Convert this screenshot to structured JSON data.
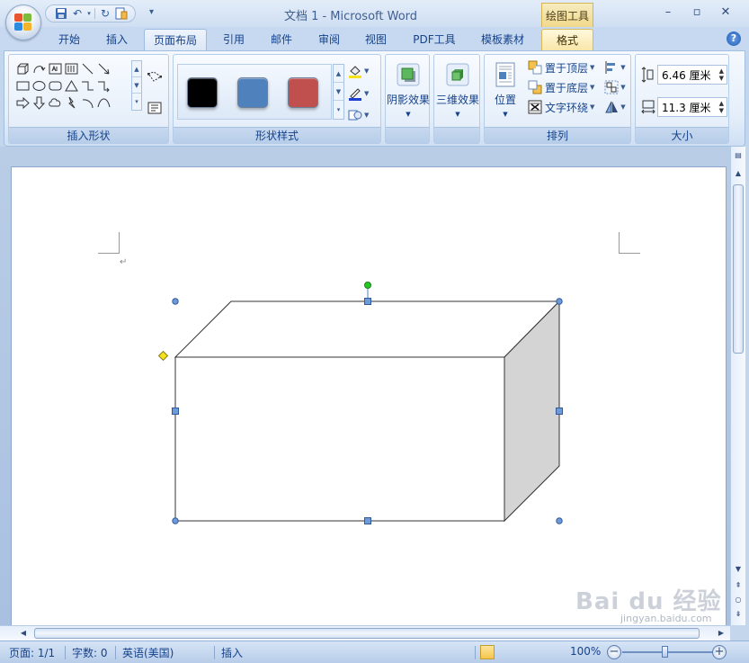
{
  "window": {
    "title": "文档 1 - Microsoft Word",
    "context_tab_group": "绘图工具",
    "minimize": "–",
    "restore": "▫",
    "close": "✕"
  },
  "qat": {
    "more": "▾"
  },
  "tabs": [
    "开始",
    "插入",
    "页面布局",
    "引用",
    "邮件",
    "审阅",
    "视图",
    "PDF工具",
    "模板素材",
    "格式"
  ],
  "help": "?",
  "ribbon": {
    "insert_shapes_label": "插入形状",
    "shape_styles_label": "形状样式",
    "swatch_colors": [
      "#000000",
      "#4f81bd",
      "#c0504d"
    ],
    "shadow_effects": "阴影效果",
    "3d_effects": "三维效果",
    "arrange_label": "排列",
    "position": "位置",
    "bring_to_front": "置于顶层",
    "send_to_back": "置于底层",
    "text_wrap": "文字环绕",
    "size_label": "大小",
    "height_value": "6.46 厘米",
    "width_value": "11.3 厘米"
  },
  "status": {
    "page": "页面: 1/1",
    "words": "字数: 0",
    "language": "英语(美国)",
    "mode": "插入",
    "zoom": "100%"
  },
  "watermark": {
    "brand": "Bai du 经验",
    "url": "jingyan.baidu.com"
  },
  "colors": {
    "accent": "#15428b",
    "selection_handle": "#4f81bd",
    "rotate_handle": "#22c922",
    "adjust_handle": "#f5e11c",
    "cube_side": "#d4d4d4"
  }
}
